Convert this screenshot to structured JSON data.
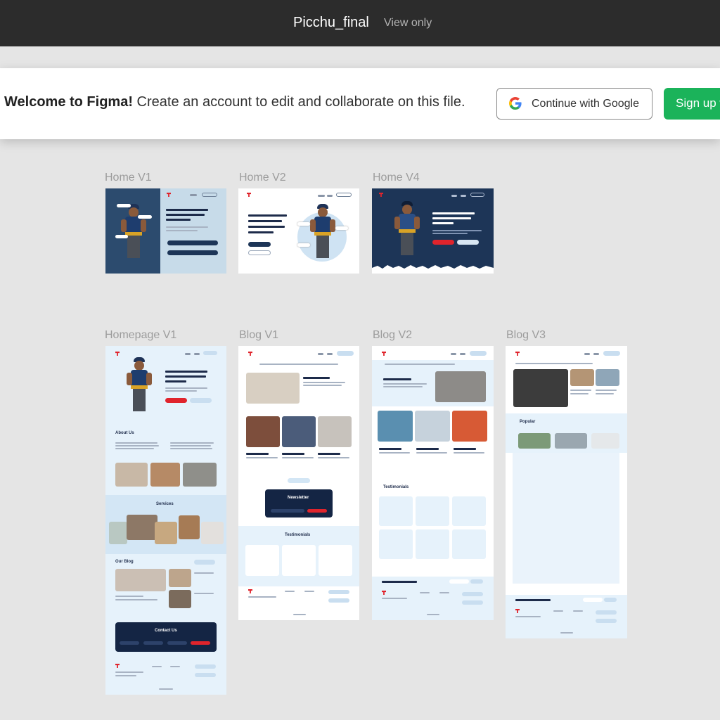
{
  "topbar": {
    "file_name": "Picchu_final",
    "mode": "View only"
  },
  "banner": {
    "welcome_bold": "Welcome to Figma!",
    "welcome_text": " Create an account to edit and collaborate on this file.",
    "google_label": "Continue with Google",
    "signup_label": "Sign up w"
  },
  "frames": {
    "home_v1": "Home V1",
    "home_v2": "Home V2",
    "home_v4": "Home V4",
    "homepage_v1": "Homepage V1",
    "blog_v1": "Blog V1",
    "blog_v2": "Blog V2",
    "blog_v3": "Blog V3"
  },
  "mini": {
    "about_us": "About Us",
    "services": "Services",
    "our_blog": "Our Blog",
    "contact_us": "Contact Us",
    "newsletter": "Newsletter",
    "testimonials": "Testimonials",
    "popular": "Popular",
    "hero_v4": "We are Singapore's best \"Post tenancy reinstatement Specialist\"",
    "hero_v2": "We are Singapore's best \"Post tenancy reinstatement Specialist\""
  },
  "colors": {
    "topbar": "#2c2c2c",
    "signup_green": "#1bb35a",
    "navy": "#1d3557",
    "light_blue": "#e6f2fb",
    "accent_red": "#e0242c"
  },
  "icons": [
    "google-icon",
    "logo-icon",
    "phone-icon"
  ]
}
